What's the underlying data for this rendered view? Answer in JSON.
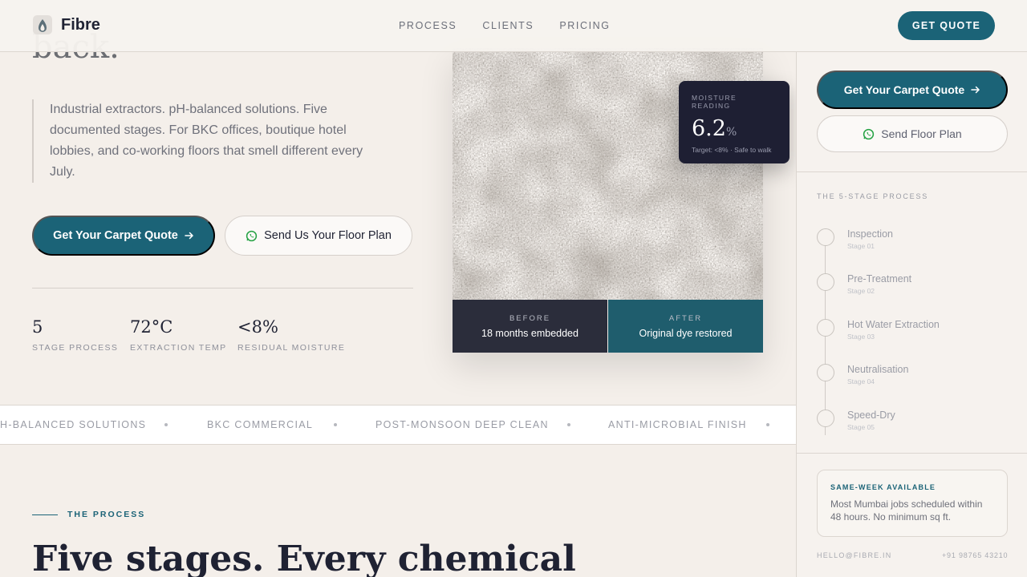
{
  "nav": {
    "brand": "Fibre",
    "links": [
      "PROCESS",
      "CLIENTS",
      "PRICING"
    ],
    "cta": "GET QUOTE"
  },
  "hero": {
    "headline_partial": "back.",
    "description": "Industrial extractors. pH-balanced solutions. Five documented stages. For BKC offices, boutique hotel lobbies, and co-working floors that smell different every July.",
    "primary_button": "Get Your Carpet Quote",
    "secondary_button": "Send Us Your Floor Plan",
    "stats": [
      {
        "value": "5",
        "label": "STAGE PROCESS"
      },
      {
        "value": "72°C",
        "label": "EXTRACTION TEMP"
      },
      {
        "value": "<8%",
        "label": "RESIDUAL MOISTURE"
      }
    ]
  },
  "image_card": {
    "before_label": "BEFORE",
    "before_text": "18 months embedded",
    "after_label": "AFTER",
    "after_text": "Original dye restored"
  },
  "moisture": {
    "label": "MOISTURE READING",
    "value": "6.2",
    "unit": "%",
    "note": "Target: <8% · Safe to walk"
  },
  "marquee": [
    "H-BALANCED SOLUTIONS",
    "BKC COMMERCIAL",
    "POST-MONSOON DEEP CLEAN",
    "ANTI-MICROBIAL FINISH"
  ],
  "process_section": {
    "eyebrow": "THE PROCESS",
    "title": "Five stages. Every chemical"
  },
  "sidebar": {
    "primary_button": "Get Your Carpet Quote",
    "secondary_button": "Send Floor Plan",
    "heading": "THE 5-STAGE PROCESS",
    "stages": [
      {
        "name": "Inspection",
        "sub": "Stage 01"
      },
      {
        "name": "Pre-Treatment",
        "sub": "Stage 02"
      },
      {
        "name": "Hot Water Extraction",
        "sub": "Stage 03"
      },
      {
        "name": "Neutralisation",
        "sub": "Stage 04"
      },
      {
        "name": "Speed-Dry",
        "sub": "Stage 05"
      }
    ],
    "availability_title": "SAME-WEEK AVAILABLE",
    "availability_text": "Most Mumbai jobs scheduled within 48 hours. No minimum sq ft.",
    "email": "HELLO@FIBRE.IN",
    "phone": "+91 98765 43210"
  },
  "colors": {
    "accent": "#1b6377",
    "background": "#f4efea",
    "dark_card": "#1e1f33"
  },
  "icons": [
    "logo-mark-icon",
    "arrow-right-icon",
    "whatsapp-icon"
  ]
}
